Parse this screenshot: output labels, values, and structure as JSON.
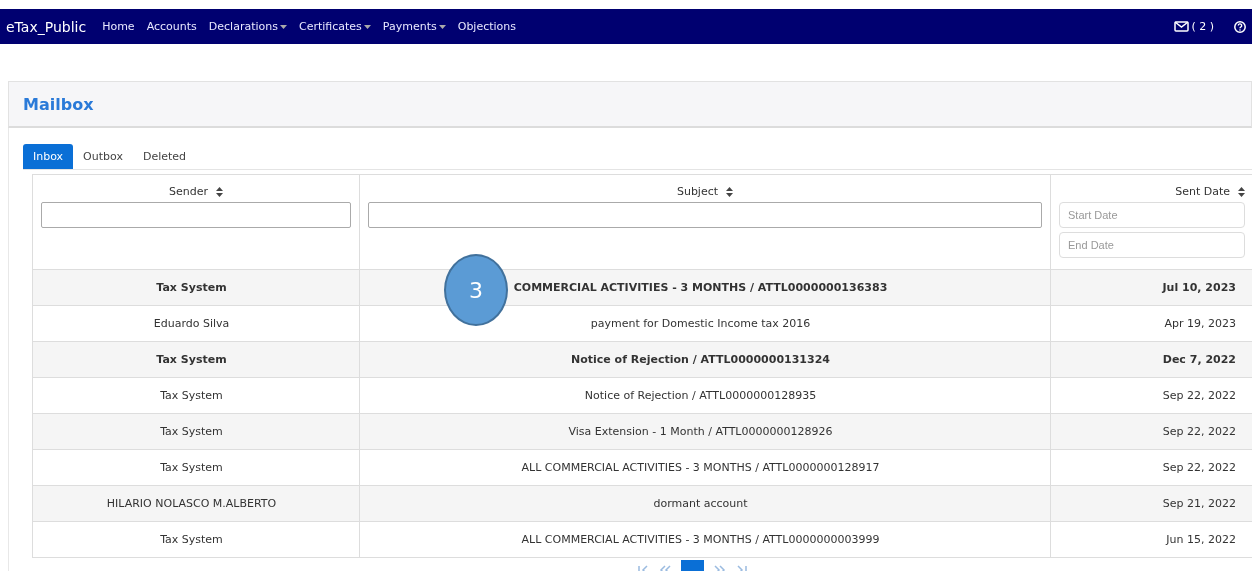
{
  "navbar": {
    "brand": "eTax_Public",
    "items": [
      {
        "label": "Home",
        "dropdown": false
      },
      {
        "label": "Accounts",
        "dropdown": false
      },
      {
        "label": "Declarations",
        "dropdown": true
      },
      {
        "label": "Certificates",
        "dropdown": true
      },
      {
        "label": "Payments",
        "dropdown": true
      },
      {
        "label": "Objections",
        "dropdown": false
      }
    ],
    "mail_count": "( 2 )"
  },
  "panel_title": "Mailbox",
  "tabs": [
    {
      "label": "Inbox",
      "selected": true
    },
    {
      "label": "Outbox",
      "selected": false
    },
    {
      "label": "Deleted",
      "selected": false
    }
  ],
  "table": {
    "columns": [
      {
        "label": "Sender",
        "kind": "text"
      },
      {
        "label": "Subject",
        "kind": "text"
      },
      {
        "label": "Sent Date",
        "kind": "dates",
        "start_placeholder": "Start Date",
        "end_placeholder": "End Date"
      }
    ],
    "rows": [
      {
        "sender": "Tax System",
        "subject": "COMMERCIAL ACTIVITIES - 3 MONTHS / ATTL0000000136383",
        "date": "Jul 10, 2023",
        "unread": true
      },
      {
        "sender": "Eduardo Silva",
        "subject": "payment for Domestic Income tax 2016",
        "date": "Apr 19, 2023",
        "unread": false
      },
      {
        "sender": "Tax System",
        "subject": "Notice of Rejection / ATTL0000000131324",
        "date": "Dec 7, 2022",
        "unread": true
      },
      {
        "sender": "Tax System",
        "subject": "Notice of Rejection / ATTL0000000128935",
        "date": "Sep 22, 2022",
        "unread": false
      },
      {
        "sender": "Tax System",
        "subject": "Visa Extension - 1 Month / ATTL0000000128926",
        "date": "Sep 22, 2022",
        "unread": false
      },
      {
        "sender": "Tax System",
        "subject": "ALL COMMERCIAL ACTIVITIES - 3 MONTHS / ATTL0000000128917",
        "date": "Sep 22, 2022",
        "unread": false
      },
      {
        "sender": "HILARIO NOLASCO M.ALBERTO",
        "subject": "dormant account",
        "date": "Sep 21, 2022",
        "unread": false
      },
      {
        "sender": "Tax System",
        "subject": "ALL COMMERCIAL ACTIVITIES - 3 MONTHS / ATTL0000000003999",
        "date": "Jun 15, 2022",
        "unread": false
      }
    ]
  },
  "callout": {
    "label": "3"
  }
}
